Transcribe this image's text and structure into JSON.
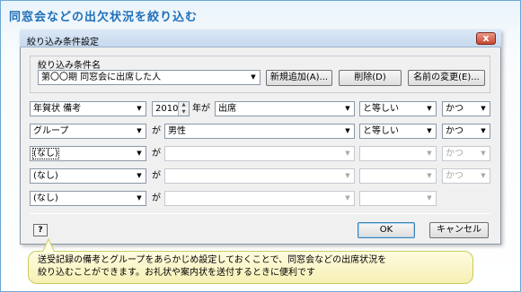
{
  "heading": "同窓会などの出欠状況を絞り込む",
  "dialog": {
    "title": "絞り込み条件設定",
    "close_symbol": "x",
    "group_label": "絞り込み条件名",
    "condition_name": "第〇〇期 同窓会に出席した人",
    "buttons": {
      "add_new": "新規追加(A)...",
      "delete": "削除(D)",
      "rename": "名前の変更(E)...",
      "ok": "OK",
      "cancel": "キャンセル",
      "help": "?"
    },
    "rows": [
      {
        "field": "年賀状 備考",
        "year": "2010",
        "connector": "年が",
        "value": "出席",
        "operator": "と等しい",
        "logic": "かつ"
      },
      {
        "field": "グループ",
        "connector": "が",
        "value": "男性",
        "operator": "と等しい",
        "logic": "かつ"
      },
      {
        "field": "(なし)",
        "connector": "が",
        "value": "",
        "operator": "",
        "logic": "かつ"
      },
      {
        "field": "(なし)",
        "connector": "が",
        "value": "",
        "operator": "",
        "logic": "かつ"
      },
      {
        "field": "(なし)",
        "connector": "が",
        "value": "",
        "operator": ""
      }
    ]
  },
  "callout": {
    "line1": "送受記録の備考とグループをあらかじめ設定しておくことで、同窓会などの出席状況を",
    "line2": "絞り込むことができます。お礼状や案内状を送付するときに便利です"
  }
}
